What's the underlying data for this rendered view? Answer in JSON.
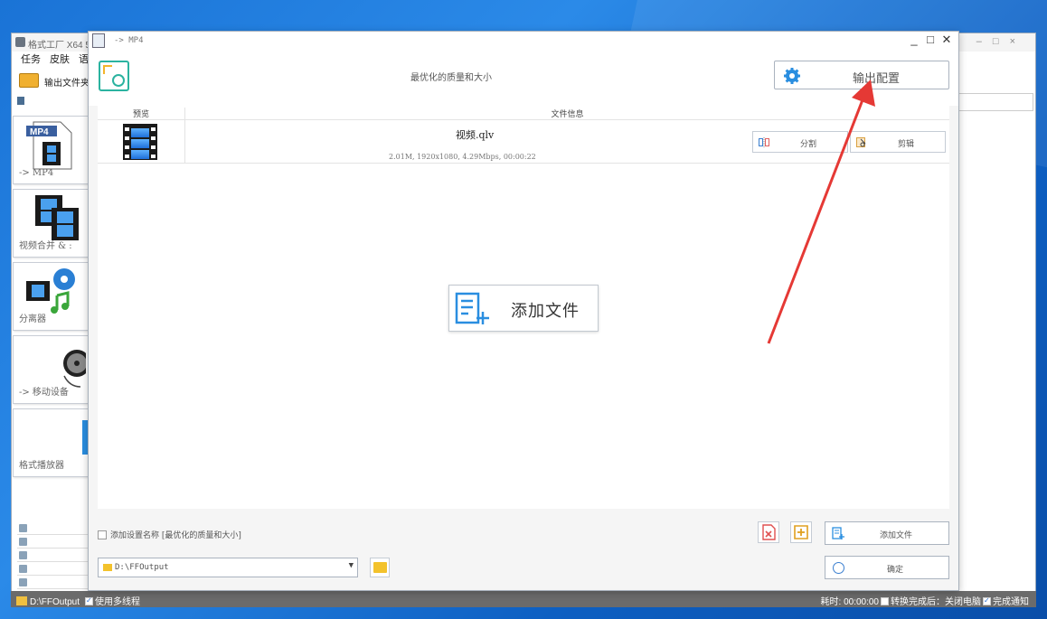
{
  "main_window": {
    "title": "格式工厂 X64 5",
    "menu": [
      "任务",
      "皮肤",
      "语"
    ],
    "toolbar_label": "输出文件夹",
    "sidebar": [
      {
        "label": "-> MP4",
        "icon": "mp4-file-icon"
      },
      {
        "label": "视频合并 & :",
        "icon": "video-merge-icon"
      },
      {
        "label": "分离器",
        "icon": "splitter-icon"
      },
      {
        "label": "-> 移动设备",
        "icon": "mobile-device-icon"
      },
      {
        "label": "格式播放器",
        "icon": "player-icon"
      }
    ],
    "window_controls": [
      "–",
      "□",
      "×"
    ]
  },
  "statusbar": {
    "output_path": "D:\\FFOutput",
    "multithread_label": "使用多线程",
    "elapsed_label": "耗时: 00:00:00",
    "after_convert_label": "转换完成后：关闭电脑",
    "notify_label": "完成通知"
  },
  "dialog": {
    "title": "-> MP4",
    "window_controls": {
      "minimize": "_",
      "maximize": "□",
      "close": "✕"
    },
    "header_center": "最优化的质量和大小",
    "output_config_label": "输出配置",
    "table": {
      "headers": [
        "预览",
        "文件信息"
      ],
      "rows": [
        {
          "filename": "视频.qlv",
          "info": "2.01M, 1920x1080, 4.29Mbps, 00:00:22",
          "split_label": "分割",
          "edit_label": "剪辑"
        }
      ]
    },
    "add_file_big_label": "添加文件",
    "setting_name_label": "添加设置名称 [最优化的质量和大小]",
    "output_path": "D:\\FFOutput",
    "add_file_label": "添加文件",
    "ok_label": "确定"
  },
  "colors": {
    "desktop": "#1a73d6",
    "accent": "#2bb3a0",
    "annotation": "#e53935",
    "folder": "#f3c22c"
  }
}
